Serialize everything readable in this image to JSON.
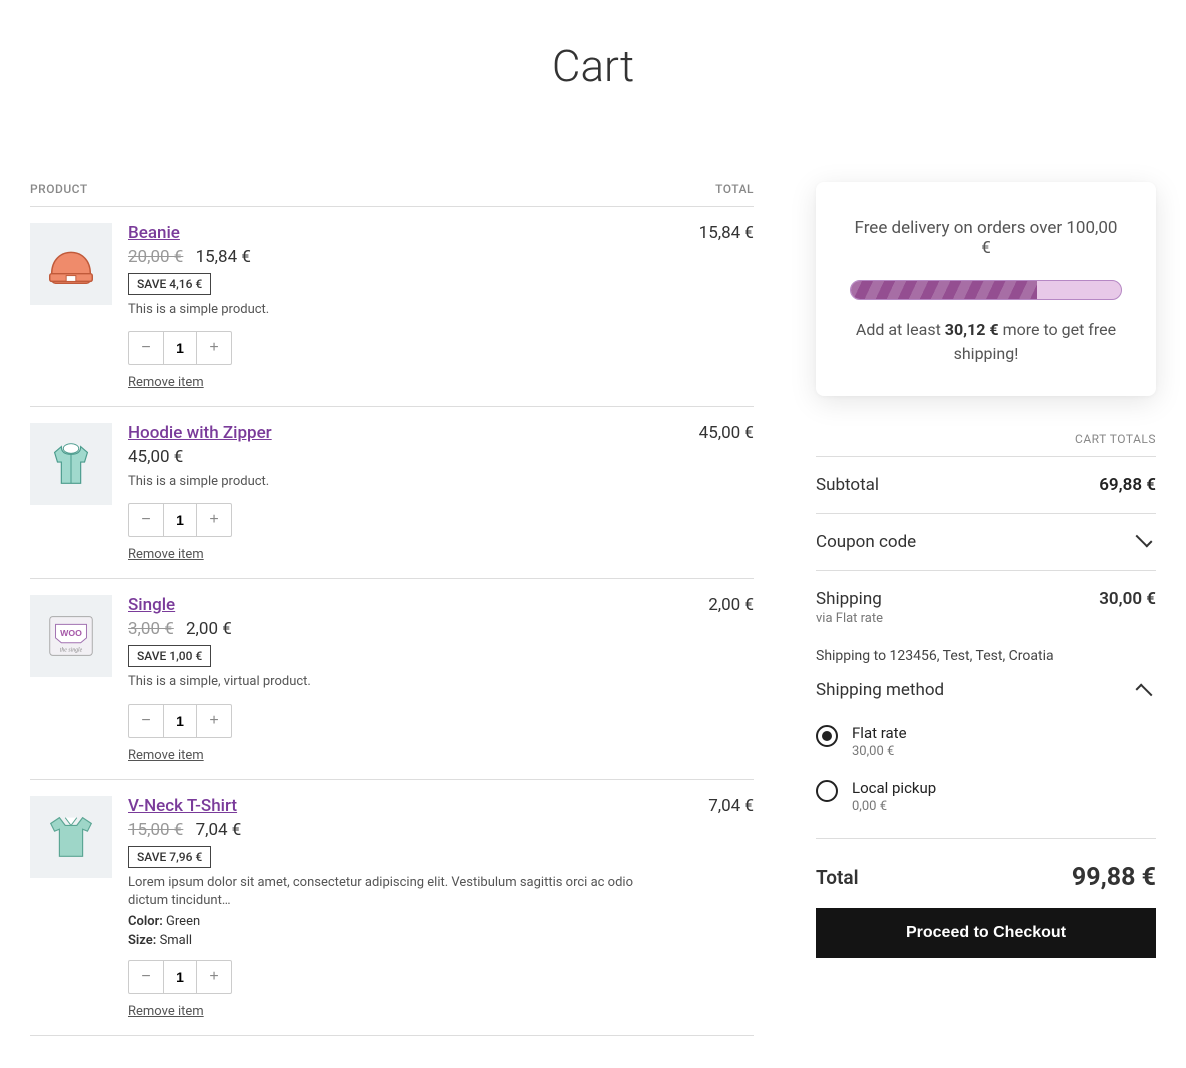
{
  "page_title": "Cart",
  "table": {
    "header_product": "PRODUCT",
    "header_total": "TOTAL"
  },
  "items": [
    {
      "name": "Beanie",
      "old_price": "20,00 €",
      "price": "15,84 €",
      "save": "SAVE 4,16 €",
      "desc": "This is a simple product.",
      "qty": "1",
      "remove": "Remove item",
      "line_total": "15,84 €",
      "has_old": true,
      "meta_color": "",
      "meta_size": ""
    },
    {
      "name": "Hoodie with Zipper",
      "old_price": "",
      "price": "45,00 €",
      "save": "",
      "desc": "This is a simple product.",
      "qty": "1",
      "remove": "Remove item",
      "line_total": "45,00 €",
      "has_old": false,
      "meta_color": "",
      "meta_size": ""
    },
    {
      "name": "Single",
      "old_price": "3,00 €",
      "price": "2,00 €",
      "save": "SAVE 1,00 €",
      "desc": "This is a simple, virtual product.",
      "qty": "1",
      "remove": "Remove item",
      "line_total": "2,00 €",
      "has_old": true,
      "meta_color": "",
      "meta_size": ""
    },
    {
      "name": "V-Neck T-Shirt",
      "old_price": "15,00 €",
      "price": "7,04 €",
      "save": "SAVE 7,96 €",
      "desc": "Lorem ipsum dolor sit amet, consectetur adipiscing elit. Vestibulum sagittis orci ac odio dictum tincidunt…",
      "qty": "1",
      "remove": "Remove item",
      "line_total": "7,04 €",
      "has_old": true,
      "meta_color_label": "Color:",
      "meta_color": "Green",
      "meta_size_label": "Size:",
      "meta_size": "Small"
    }
  ],
  "promo": {
    "title": "Free delivery on orders over 100,00 €",
    "progress_percent": 69,
    "msg_before": "Add at least ",
    "msg_amount": "30,12 €",
    "msg_after": " more to get free shipping!"
  },
  "totals": {
    "header": "CART TOTALS",
    "subtotal_label": "Subtotal",
    "subtotal_value": "69,88 €",
    "coupon_label": "Coupon code",
    "shipping_label": "Shipping",
    "shipping_value": "30,00 €",
    "shipping_via": "via Flat rate",
    "shipping_to": "Shipping to 123456, Test, Test, Croatia",
    "shipping_method_label": "Shipping method",
    "options": [
      {
        "name": "Flat rate",
        "price": "30,00 €",
        "selected": true
      },
      {
        "name": "Local pickup",
        "price": "0,00 €",
        "selected": false
      }
    ],
    "total_label": "Total",
    "total_value": "99,88 €",
    "checkout": "Proceed to Checkout"
  }
}
